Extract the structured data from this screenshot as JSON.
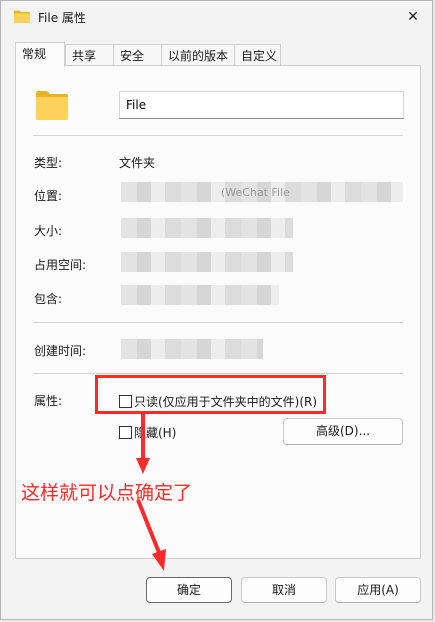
{
  "window": {
    "title": "File 属性",
    "close_glyph": "✕",
    "tabs": [
      "常规",
      "共享",
      "安全",
      "以前的版本",
      "自定义"
    ]
  },
  "general": {
    "name_value": "File",
    "type_label": "类型:",
    "type_value": "文件夹",
    "location_label": "位置:",
    "location_partial": "(WeChat File",
    "size_label": "大小:",
    "size_on_disk_label": "占用空间:",
    "contains_label": "包含:",
    "created_label": "创建时间:",
    "attributes_label": "属性:",
    "readonly_label": "只读(仅应用于文件夹中的文件)(R)",
    "hidden_label": "隐藏(H)",
    "advanced_button": "高级(D)..."
  },
  "footer": {
    "ok": "确定",
    "cancel": "取消",
    "apply": "应用(A)"
  },
  "annotation": {
    "text": "这样就可以点确定了",
    "color": "#ff2a2a"
  },
  "background": {
    "partial_text": "这"
  },
  "icons": [
    "folder-icon",
    "close-icon",
    "checkbox-icon",
    "arrow-icon"
  ]
}
